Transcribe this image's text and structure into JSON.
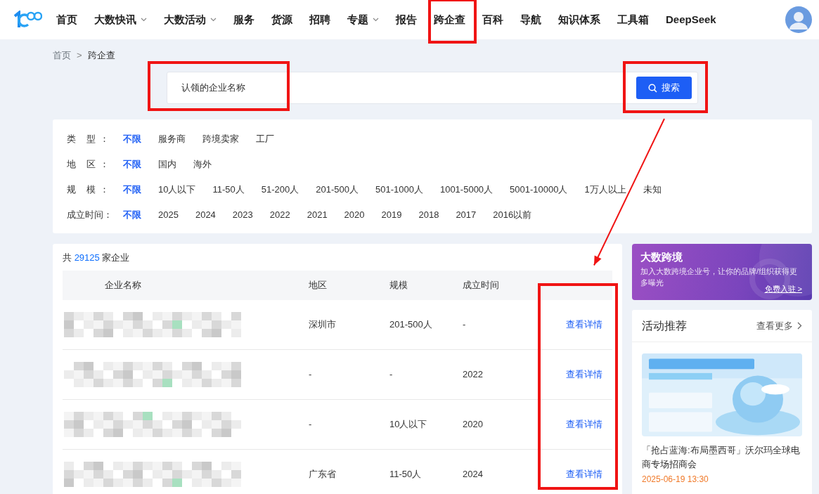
{
  "nav": {
    "items": [
      {
        "label": "首页",
        "dropdown": false,
        "annotated": false
      },
      {
        "label": "大数快讯",
        "dropdown": true,
        "annotated": false
      },
      {
        "label": "大数活动",
        "dropdown": true,
        "annotated": false
      },
      {
        "label": "服务",
        "dropdown": false,
        "annotated": false
      },
      {
        "label": "货源",
        "dropdown": false,
        "annotated": false
      },
      {
        "label": "招聘",
        "dropdown": false,
        "annotated": false
      },
      {
        "label": "专题",
        "dropdown": true,
        "annotated": false
      },
      {
        "label": "报告",
        "dropdown": false,
        "annotated": false
      },
      {
        "label": "跨企查",
        "dropdown": false,
        "annotated": true
      },
      {
        "label": "百科",
        "dropdown": false,
        "annotated": false
      },
      {
        "label": "导航",
        "dropdown": false,
        "annotated": false
      },
      {
        "label": "知识体系",
        "dropdown": false,
        "annotated": false
      },
      {
        "label": "工具箱",
        "dropdown": false,
        "annotated": false
      },
      {
        "label": "DeepSeek",
        "dropdown": false,
        "annotated": false
      }
    ]
  },
  "breadcrumb": {
    "items": [
      "首页",
      "跨企查"
    ],
    "separator": ">"
  },
  "search": {
    "placeholder": "认领的企业名称",
    "input_annotated": true,
    "button": "搜索",
    "button_annotated": true
  },
  "filters": [
    {
      "label": "类 型：",
      "options": [
        {
          "label": "不限",
          "selected": true
        },
        {
          "label": "服务商",
          "selected": false
        },
        {
          "label": "跨境卖家",
          "selected": false
        },
        {
          "label": "工厂",
          "selected": false
        }
      ]
    },
    {
      "label": "地 区：",
      "options": [
        {
          "label": "不限",
          "selected": true
        },
        {
          "label": "国内",
          "selected": false
        },
        {
          "label": "海外",
          "selected": false
        }
      ]
    },
    {
      "label": "规 模：",
      "options": [
        {
          "label": "不限",
          "selected": true
        },
        {
          "label": "10人以下",
          "selected": false
        },
        {
          "label": "11-50人",
          "selected": false
        },
        {
          "label": "51-200人",
          "selected": false
        },
        {
          "label": "201-500人",
          "selected": false
        },
        {
          "label": "501-1000人",
          "selected": false
        },
        {
          "label": "1001-5000人",
          "selected": false
        },
        {
          "label": "5001-10000人",
          "selected": false
        },
        {
          "label": "1万人以上",
          "selected": false
        },
        {
          "label": "未知",
          "selected": false
        }
      ]
    },
    {
      "label": "成立时间：",
      "options": [
        {
          "label": "不限",
          "selected": true
        },
        {
          "label": "2025",
          "selected": false
        },
        {
          "label": "2024",
          "selected": false
        },
        {
          "label": "2023",
          "selected": false
        },
        {
          "label": "2022",
          "selected": false
        },
        {
          "label": "2021",
          "selected": false
        },
        {
          "label": "2020",
          "selected": false
        },
        {
          "label": "2019",
          "selected": false
        },
        {
          "label": "2018",
          "selected": false
        },
        {
          "label": "2017",
          "selected": false
        },
        {
          "label": "2016以前",
          "selected": false
        }
      ]
    }
  ],
  "results": {
    "count_prefix": "共",
    "count": "29125",
    "count_suffix": "家企业",
    "action_column_annotated": true,
    "arrow_annotation": true,
    "columns": [
      "企业名称",
      "地区",
      "规模",
      "成立时间"
    ],
    "rows": [
      {
        "name_blurred": true,
        "region": "深圳市",
        "scale": "201-500人",
        "founded": "-",
        "action": "查看详情"
      },
      {
        "name_blurred": true,
        "region": "-",
        "scale": "-",
        "founded": "2022",
        "action": "查看详情"
      },
      {
        "name_blurred": true,
        "region": "-",
        "scale": "10人以下",
        "founded": "2020",
        "action": "查看详情"
      },
      {
        "name_blurred": true,
        "region": "广东省",
        "scale": "11-50人",
        "founded": "2024",
        "action": "查看详情"
      }
    ]
  },
  "promo": {
    "brand": "大数跨境",
    "text": "加入大数跨境企业号，让你的品牌/组织获得更多曝光",
    "link": "免费入驻 >"
  },
  "activities": {
    "title": "活动推荐",
    "more": "查看更多",
    "items": [
      {
        "kind": "picture",
        "title": "「抢占蓝海:布局墨西哥」沃尔玛全球电商专场招商会",
        "date": "2025-06-19 13:30"
      }
    ]
  }
}
